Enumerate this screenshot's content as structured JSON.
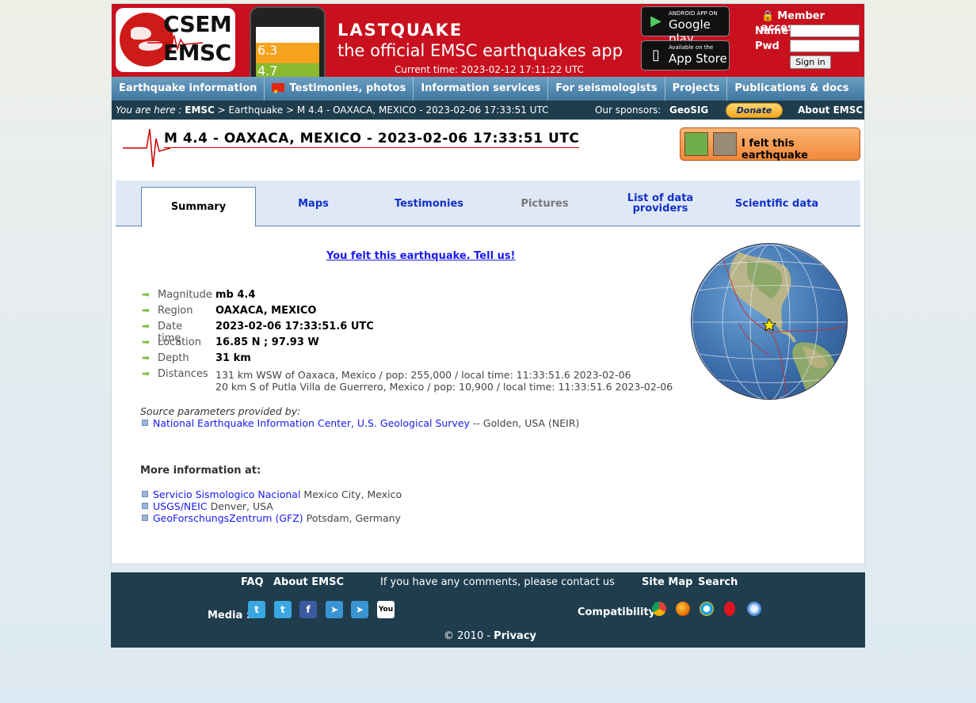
{
  "banner": {
    "logo_top": "CSEM",
    "logo_bottom": "EMSC",
    "phone_mag_1": "6.3",
    "phone_mag_2": "4.7",
    "app_title": "LASTQUAKE",
    "app_subtitle": "the official EMSC earthquakes app",
    "current_time": "Current time: 2023-02-12 17:11:22 UTC",
    "google_play_small": "ANDROID APP ON",
    "google_play_big": "Google play",
    "app_store_small": "Available on the",
    "app_store_big": "App Store",
    "member_access": "Member access",
    "name_label": "Name",
    "pwd_label": "Pwd",
    "name_value": "",
    "pwd_value": "",
    "sign_in": "Sign in"
  },
  "nav": {
    "items": [
      {
        "label": "Earthquake information"
      },
      {
        "label": "Testimonies, photos"
      },
      {
        "label": "Information services"
      },
      {
        "label": "For seismologists"
      },
      {
        "label": "Projects"
      },
      {
        "label": "Publications & docs"
      }
    ]
  },
  "breadcrumb": {
    "prefix": "You are here :",
    "emsc": "EMSC",
    "sep1": " > ",
    "earthquake": "Earthquake",
    "sep2": " > ",
    "current": "M 4.4 - OAXACA, MEXICO - 2023-02-06 17:33:51 UTC",
    "sponsors_label": "Our sponsors:",
    "sponsor": "GeoSIG",
    "donate": "Donate",
    "about": "About EMSC"
  },
  "event": {
    "title": "M 4.4 - OAXACA, MEXICO - 2023-02-06 17:33:51 UTC",
    "felt_button": "I felt this earthquake",
    "tell_us": "You felt this earthquake. Tell us!"
  },
  "tabs": [
    {
      "label": "Summary"
    },
    {
      "label": "Maps"
    },
    {
      "label": "Testimonies"
    },
    {
      "label": "Pictures"
    },
    {
      "label": "List of data providers"
    },
    {
      "label": "Scientific data"
    }
  ],
  "params": {
    "magnitude_label": "Magnitude",
    "magnitude": "mb 4.4",
    "region_label": "Region",
    "region": "OAXACA, MEXICO",
    "datetime_label": "Date time",
    "datetime": "2023-02-06 17:33:51.6 UTC",
    "location_label": "Location",
    "location": "16.85 N ; 97.93 W",
    "depth_label": "Depth",
    "depth": "31 km",
    "distances_label": "Distances",
    "distance_1": "131 km WSW of Oaxaca, Mexico / pop: 255,000 / local time: 11:33:51.6 2023-02-06",
    "distance_2": "20 km S of Putla Villa de Guerrero, Mexico / pop: 10,900 / local time: 11:33:51.6 2023-02-06"
  },
  "source": {
    "label": "Source parameters provided by:",
    "provider_link": "National Earthquake Information Center, U.S. Geological Survey",
    "provider_suffix": " -- Golden, USA (NEIR)"
  },
  "more_info": {
    "heading": "More information at:",
    "items": [
      {
        "link": "Servicio Sismologico Nacional",
        "place": " Mexico City, Mexico"
      },
      {
        "link": "USGS/NEIC",
        "place": " Denver, USA"
      },
      {
        "link": "GeoForschungsZentrum (GFZ)",
        "place": " Potsdam, Germany"
      }
    ]
  },
  "footer": {
    "faq": "FAQ",
    "about": "About EMSC",
    "comments": "If you have any comments, please contact us",
    "site_map": "Site Map",
    "search": "Search",
    "media_label": "Media :",
    "compat_label": "Compatibility :",
    "copyright": "© 2010 - ",
    "privacy": "Privacy",
    "media_icons": [
      "twitter-icon",
      "twitter-icon",
      "facebook-icon",
      "telegram-icon",
      "telegram-icon",
      "youtube-icon"
    ],
    "youtube_text": "You"
  },
  "colors": {
    "banner_red": "#c8101e",
    "nav_blue": "#3f77a0",
    "dark_bar": "#1f3d4d",
    "link_blue": "#1a1aee",
    "tabs_bg": "#dfe8f6"
  }
}
